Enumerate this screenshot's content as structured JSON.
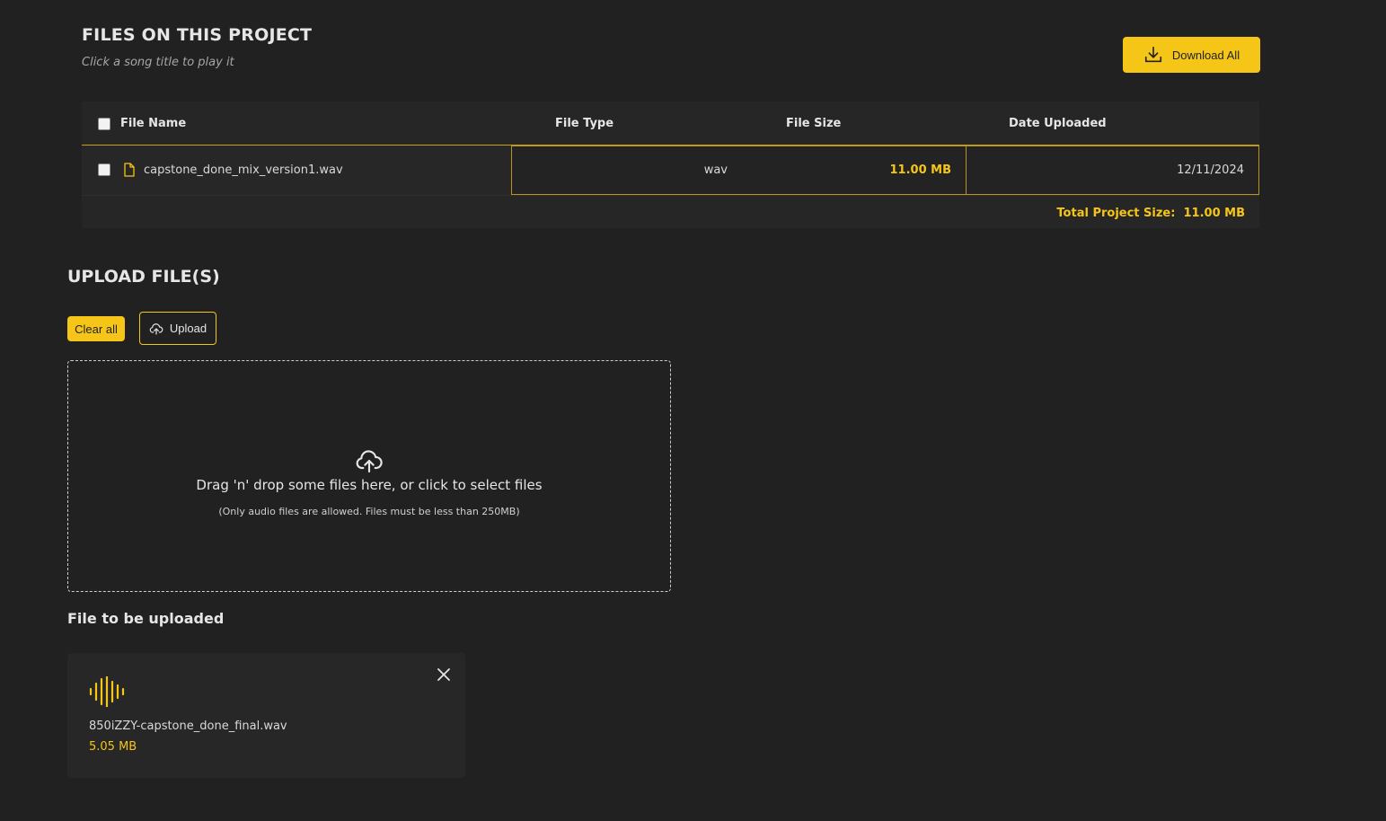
{
  "files_section": {
    "title": "FILES ON THIS PROJECT",
    "subtitle": "Click a song title to play it",
    "download_all_label": "Download All"
  },
  "table": {
    "headers": {
      "file_name": "File Name",
      "file_type": "File Type",
      "file_size": "File Size",
      "date_uploaded": "Date Uploaded"
    },
    "rows": [
      {
        "name": "capstone_done_mix_version1.wav",
        "type": "wav",
        "size": "11.00 MB",
        "date": "12/11/2024"
      }
    ],
    "total_label": "Total Project Size:",
    "total_value": "11.00 MB"
  },
  "upload_section": {
    "title": "UPLOAD FILE(S)",
    "clear_label": "Clear all",
    "upload_label": "Upload",
    "dropzone_main": "Drag 'n' drop some files here, or click to select files",
    "dropzone_sub": "(Only audio files are allowed. Files must be less than 250MB)"
  },
  "pending": {
    "title": "File to be uploaded",
    "files": [
      {
        "name": "850iZZY-capstone_done_final.wav",
        "size": "5.05 MB"
      }
    ]
  },
  "icons": {
    "download": "download-icon",
    "file": "file-icon",
    "cloud_upload": "cloud-upload-icon",
    "audio_wave": "audio-wave-icon",
    "close": "close-icon"
  },
  "colors": {
    "background": "#212121",
    "accent": "#f5c518",
    "panel": "#262626",
    "text": "#e6e6e6"
  }
}
